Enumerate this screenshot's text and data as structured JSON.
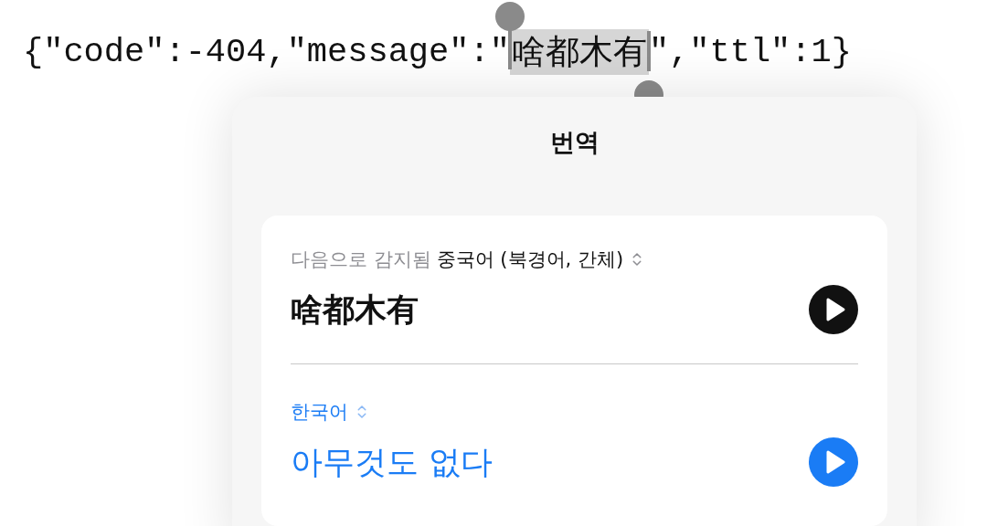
{
  "code_line": {
    "before": "{\"code\":-404,\"message\":\"",
    "selected": "啥都木有",
    "after": "\",\"ttl\":1}"
  },
  "popover": {
    "title": "번역",
    "source": {
      "detected_label": "다음으로 감지됨",
      "language": "중국어 (북경어, 간체)",
      "text": "啥都木有"
    },
    "target": {
      "language": "한국어",
      "text": "아무것도 없다"
    }
  }
}
